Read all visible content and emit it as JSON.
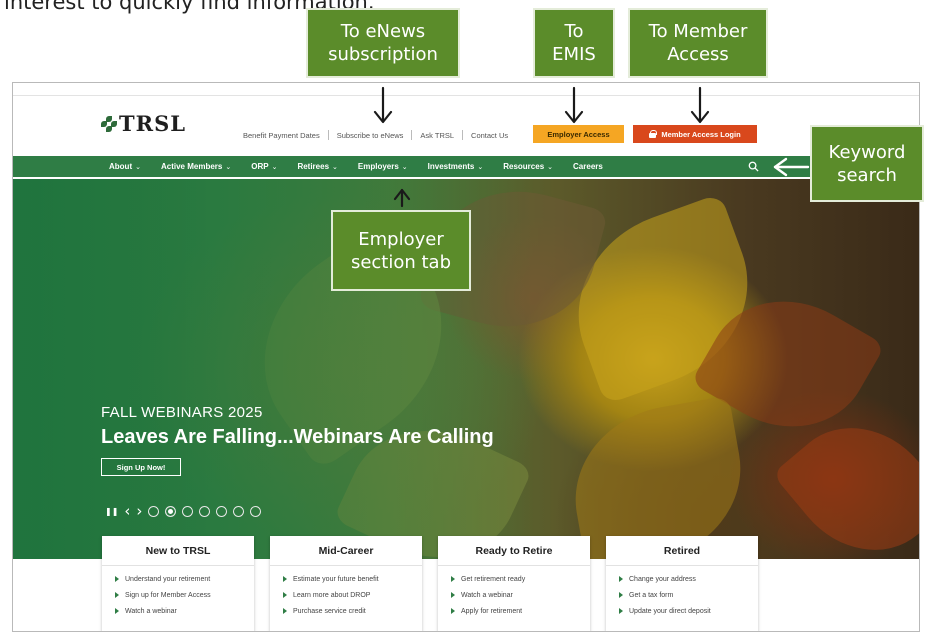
{
  "caption_fragment": "interest to quickly find information.",
  "site": {
    "logo_text": "TRSL",
    "utility_links": [
      "Benefit Payment Dates",
      "Subscribe to eNews",
      "Ask TRSL",
      "Contact Us"
    ],
    "employer_button": "Employer Access",
    "member_button": "Member Access Login",
    "nav": [
      "About",
      "Active Members",
      "ORP",
      "Retirees",
      "Employers",
      "Investments",
      "Resources",
      "Careers"
    ],
    "nav_chevron": "⌄",
    "accent_green": "#2f7d45",
    "employer_orange": "#f5a623",
    "member_red": "#d9481c"
  },
  "hero": {
    "eyebrow": "FALL WEBINARS 2025",
    "title": "Leaves Are Falling...Webinars Are Calling",
    "cta": "Sign Up Now!",
    "pause_icon": "❚❚",
    "prev_icon": "‹",
    "next_icon": "›",
    "slide_count": 7,
    "active_slide": 2
  },
  "cards": [
    {
      "title": "New to TRSL",
      "links": [
        "Understand your retirement",
        "Sign up for Member Access",
        "Watch a webinar"
      ]
    },
    {
      "title": "Mid-Career",
      "links": [
        "Estimate your future benefit",
        "Learn more about DROP",
        "Purchase service credit"
      ]
    },
    {
      "title": "Ready to Retire",
      "links": [
        "Get retirement ready",
        "Watch a webinar",
        "Apply for retirement"
      ]
    },
    {
      "title": "Retired",
      "links": [
        "Change your address",
        "Get a tax form",
        "Update your direct deposit"
      ]
    }
  ],
  "callouts": {
    "enews": [
      "To eNews",
      "subscription"
    ],
    "emis": [
      "To",
      "EMIS"
    ],
    "member": [
      "To Member",
      "Access"
    ],
    "search": [
      "Keyword",
      "search"
    ],
    "employer": [
      "Employer",
      "section tab"
    ],
    "color": "#5b8c2a"
  }
}
